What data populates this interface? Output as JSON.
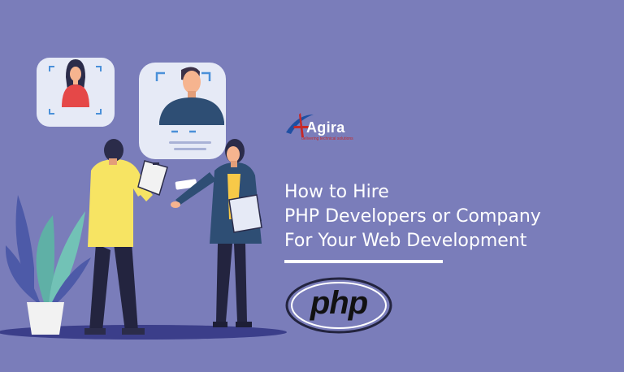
{
  "brand": {
    "name": "Agira",
    "tagline": "delivering technical solutions"
  },
  "headline": {
    "line1": "How to Hire",
    "line2": "PHP Developers or Company",
    "line3": "For Your Web Development"
  },
  "php_logo": {
    "text": "php"
  },
  "colors": {
    "background": "#7a7dba",
    "card": "#e6eaf6",
    "frame_corner": "#4a90d9",
    "woman_top": "#e54848",
    "man_shirt": "#f7e463",
    "woman_jacket": "#2e4e74",
    "plant": "#5fb0a6",
    "brand_red": "#c62828",
    "text": "#ffffff"
  },
  "icons": {
    "profile_woman": "profile-card-woman-icon",
    "profile_man": "profile-card-man-icon",
    "plant": "plant-icon",
    "brand_mark": "agira-logo-icon"
  }
}
